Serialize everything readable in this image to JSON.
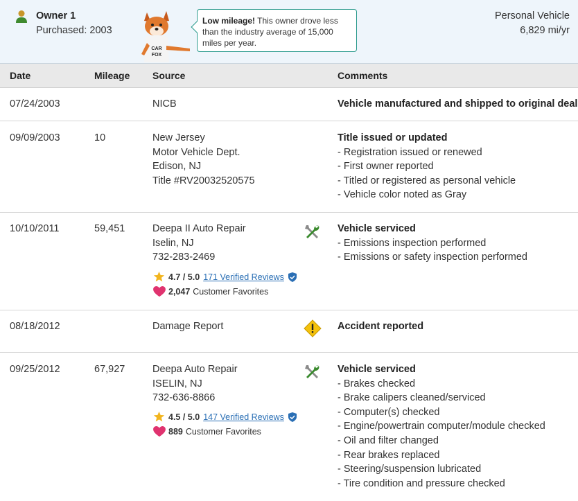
{
  "owner": {
    "title": "Owner 1",
    "purchased": "Purchased: 2003",
    "vehicle_type": "Personal Vehicle",
    "mileage_rate": "6,829 mi/yr",
    "icon": "person-icon"
  },
  "tooltip": {
    "bold": "Low mileage!",
    "text": " This owner drove less than the industry average of 15,000 miles per year."
  },
  "mascot": {
    "label_top": "CAR",
    "label_bottom": "FOX"
  },
  "columns": {
    "date": "Date",
    "mileage": "Mileage",
    "source": "Source",
    "comments": "Comments"
  },
  "records": [
    {
      "date": "07/24/2003",
      "mileage": "",
      "source": [
        "NICB"
      ],
      "comment_title": "Vehicle manufactured and shipped to original dealer",
      "comment_items": []
    },
    {
      "date": "09/09/2003",
      "mileage": "10",
      "source": [
        "New Jersey",
        "Motor Vehicle Dept.",
        "Edison, NJ",
        "Title #RV20032520575"
      ],
      "comment_title": "Title issued or updated",
      "comment_items": [
        "- Registration issued or renewed",
        "- First owner reported",
        "- Titled or registered as personal vehicle",
        "- Vehicle color noted as Gray"
      ]
    },
    {
      "date": "10/10/2011",
      "mileage": "59,451",
      "source": [
        "Deepa II Auto Repair",
        "Iselin, NJ",
        "732-283-2469"
      ],
      "rating": "4.7 / 5.0",
      "reviews": "171 Verified Reviews",
      "favorites": "2,047",
      "favorites_label": "Customer Favorites",
      "icon": "wrench-screwdriver-icon",
      "comment_title": "Vehicle serviced",
      "comment_items": [
        "- Emissions inspection performed",
        "- Emissions or safety inspection performed"
      ]
    },
    {
      "date": "08/18/2012",
      "mileage": "",
      "source": [
        "Damage Report"
      ],
      "icon": "warning-icon",
      "comment_title": "Accident reported",
      "comment_items": []
    },
    {
      "date": "09/25/2012",
      "mileage": "67,927",
      "source": [
        "Deepa Auto Repair",
        "ISELIN, NJ",
        "732-636-8866"
      ],
      "rating": "4.5 / 5.0",
      "reviews": "147 Verified Reviews",
      "favorites": "889",
      "favorites_label": "Customer Favorites",
      "icon": "wrench-screwdriver-icon",
      "comment_title": "Vehicle serviced",
      "comment_items": [
        "- Brakes checked",
        "- Brake calipers cleaned/serviced",
        "- Computer(s) checked",
        "- Engine/powertrain computer/module checked",
        "- Oil and filter changed",
        "- Rear brakes replaced",
        "- Steering/suspension lubricated",
        "- Tire condition and pressure checked"
      ]
    }
  ],
  "colors": {
    "header_bg": "#eef5fb",
    "tooltip_border": "#2a9a8c",
    "link": "#2a6fb5",
    "star": "#f2b51f",
    "heart": "#e0336f",
    "warning": "#f4c20d",
    "wrench_green": "#3a8a2e"
  }
}
